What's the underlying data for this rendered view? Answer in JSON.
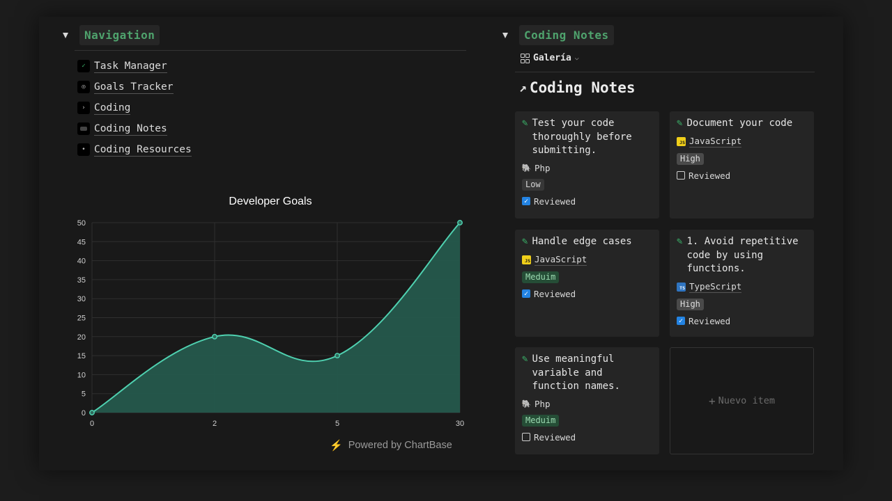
{
  "navigation": {
    "heading": "Navigation",
    "items": [
      {
        "label": "Task Manager",
        "icon": "checklist-icon"
      },
      {
        "label": "Goals Tracker",
        "icon": "target-icon"
      },
      {
        "label": "Coding",
        "icon": "terminal-icon"
      },
      {
        "label": "Coding Notes",
        "icon": "notes-icon"
      },
      {
        "label": "Coding Resources",
        "icon": "resources-icon"
      }
    ]
  },
  "chart_data": {
    "type": "area",
    "title": "Developer Goals",
    "categories": [
      "0",
      "2",
      "5",
      "30"
    ],
    "values": [
      0,
      20,
      15,
      50
    ],
    "ylim": [
      0,
      50
    ],
    "yticks": [
      "0",
      "5",
      "10",
      "15",
      "20",
      "25",
      "30",
      "35",
      "40",
      "45",
      "50"
    ],
    "grid": true,
    "line_color": "#4fd1b0",
    "fill_color": "#25594c"
  },
  "powered_by": "Powered by ChartBase",
  "coding_notes": {
    "heading": "Coding Notes",
    "view_tab": "Galería",
    "db_title": "Coding Notes",
    "new_item": "Nuevo item",
    "cards": [
      {
        "title": "Test your code thoroughly before submitting.",
        "language": "Php",
        "priority": "Low",
        "reviewed": true,
        "reviewed_label": "Reviewed"
      },
      {
        "title": "Document your code",
        "language": "JavaScript",
        "priority": "High",
        "reviewed": false,
        "reviewed_label": "Reviewed"
      },
      {
        "title": "Handle edge cases",
        "language": "JavaScript",
        "priority": "Meduim",
        "reviewed": true,
        "reviewed_label": "Reviewed"
      },
      {
        "title": "1. Avoid repetitive code by using functions.",
        "language": "TypeScript",
        "priority": "High",
        "reviewed": true,
        "reviewed_label": "Reviewed"
      },
      {
        "title": "Use meaningful variable and function names.",
        "language": "Php",
        "priority": "Meduim",
        "reviewed": false,
        "reviewed_label": "Reviewed"
      }
    ]
  },
  "colors": {
    "accent_green": "#4fa36d",
    "checkbox_blue": "#2383e2"
  }
}
